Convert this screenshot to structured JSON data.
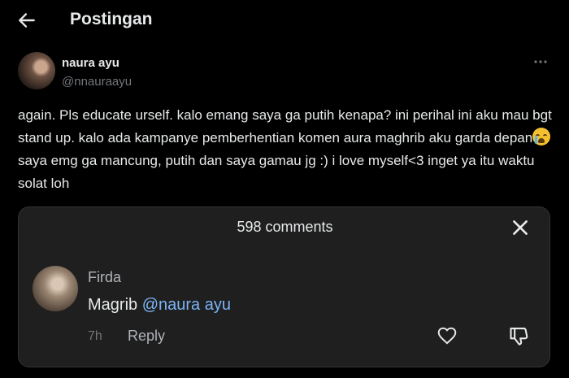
{
  "header": {
    "title": "Postingan",
    "back_icon": "arrow-left-icon"
  },
  "post": {
    "author": {
      "name": "naura ayu",
      "handle": "@nnauraayu"
    },
    "more_icon": "more-horizontal-icon",
    "text_before_emoji": "again. Pls educate urself. kalo emang saya ga putih kenapa? ini perihal ini aku mau bgt stand up. kalo ada kampanye pemberhentian komen aura maghrib aku garda depan",
    "emoji": "loudly-crying-face",
    "text_after_emoji": " saya emg ga mancung, putih dan saya gamau jg :) i love myself<3 inget ya itu waktu solat loh"
  },
  "comments_panel": {
    "title": "598 comments",
    "close_icon": "close-icon",
    "comment": {
      "author": "Firda",
      "text": "Magrib ",
      "mention": "@naura ayu",
      "time": "7h",
      "reply_label": "Reply",
      "like_icon": "heart-icon",
      "dislike_icon": "thumbs-down-icon"
    }
  },
  "colors": {
    "background": "#000000",
    "panel": "#1f1f1f",
    "mention": "#7cb4f5",
    "muted": "#71767b"
  }
}
